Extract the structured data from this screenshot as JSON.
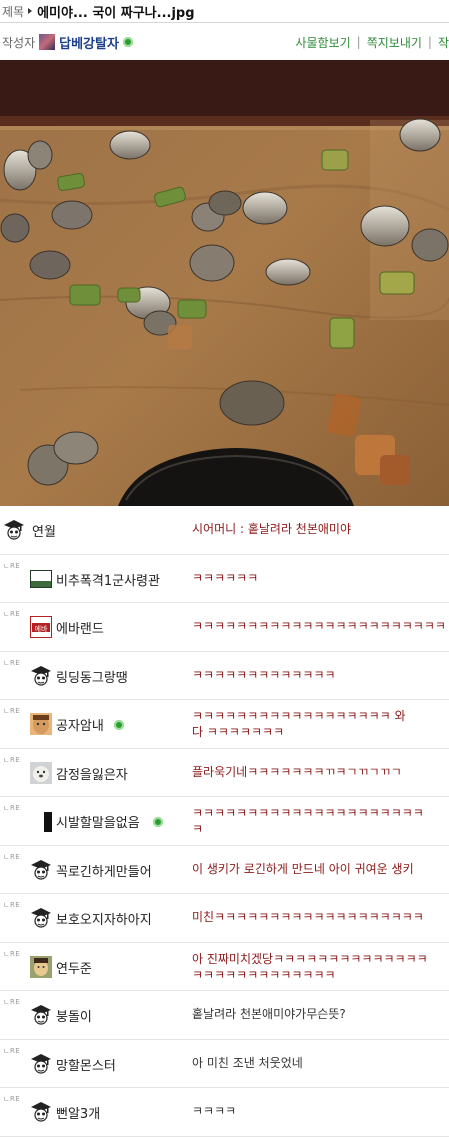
{
  "post": {
    "title_label": "제목",
    "title": "에미야... 국이 짜구나...jpg",
    "author_label": "작성자",
    "author_name": "답베강탈자",
    "links": [
      "사물함보기",
      "쪽지보내기",
      "작"
    ]
  },
  "comments": [
    {
      "name": "연월",
      "text": "시어머니 : 홑날려라 천본애미야",
      "re": "",
      "icon": "graduate-icon"
    },
    {
      "name": "비추폭격1군사령관",
      "text": "ㅋㅋㅋㅋㅋㅋ",
      "re": "RE",
      "icon": "landscape-icon"
    },
    {
      "name": "에바랜드",
      "text": "ㅋㅋㅋㅋㅋㅋㅋㅋㅋㅋㅋㅋㅋㅋㅋㅋㅋㅋㅋㅋㅋㅋㅋ",
      "re": "RE",
      "icon": "eva-badge-icon",
      "badge": "에바"
    },
    {
      "name": "링딩동그랑땡",
      "text": "ㅋㅋㅋㅋㅋㅋㅋㅋㅋㅋㅋㅋㅋ",
      "re": "RE",
      "icon": "graduate-icon"
    },
    {
      "name": "공자암내",
      "text": "ㅋㅋㅋㅋㅋㅋㅋㅋㅋㅋㅋㅋㅋㅋㅋㅋㅋㅋ 와",
      "text2": "다 ㅋㅋㅋㅋㅋㅋㅋ",
      "re": "RE",
      "icon": "face-icon",
      "online": true
    },
    {
      "name": "감정을잃은자",
      "text": "플라욱기네ㅋㅋㅋㅋㅋㅋㅋㄲㅋㄱㄲㄱㄲㄱ",
      "re": "RE",
      "icon": "dog-icon"
    },
    {
      "name": "시발할말을없음",
      "text": "ㅋㅋㅋㅋㅋㅋㅋㅋㅋㅋㅋㅋㅋㅋㅋㅋㅋㅋㅋㅋㅋ",
      "text2": "ㅋ",
      "re": "RE",
      "icon": "silhouette-icon",
      "online": true
    },
    {
      "name": "꼭로긴하게만들어",
      "text": "이 생키가 로긴하게 만드네 아이 귀여운 생키",
      "re": "RE",
      "icon": "graduate-icon"
    },
    {
      "name": "보호오지자하아지",
      "text": "미친ㅋㅋㅋㅋㅋㅋㅋㅋㅋㅋㅋㅋㅋㅋㅋㅋㅋㅋㅋ",
      "re": "RE",
      "icon": "graduate-icon"
    },
    {
      "name": "연두준",
      "text": "아 진짜미치겠당ㅋㅋㅋㅋㅋㅋㅋㅋㅋㅋㅋㅋㅋㅋ",
      "text2": "ㅋㅋㅋㅋㅋㅋㅋㅋㅋㅋㅋㅋㅋ",
      "re": "RE",
      "icon": "man-icon"
    },
    {
      "name": "붕돌이",
      "text": "홑날려라 천본애미야가무슨뜻?",
      "re": "RE",
      "icon": "graduate-icon",
      "dark": true
    },
    {
      "name": "망할몬스터",
      "text": "아 미친 조낸 처웃었네",
      "re": "RE",
      "icon": "graduate-icon",
      "dark": true
    },
    {
      "name": "뻔알3개",
      "text": "ㅋㅋㅋㅋ",
      "re": "RE",
      "icon": "graduate-icon",
      "dark": true
    }
  ]
}
